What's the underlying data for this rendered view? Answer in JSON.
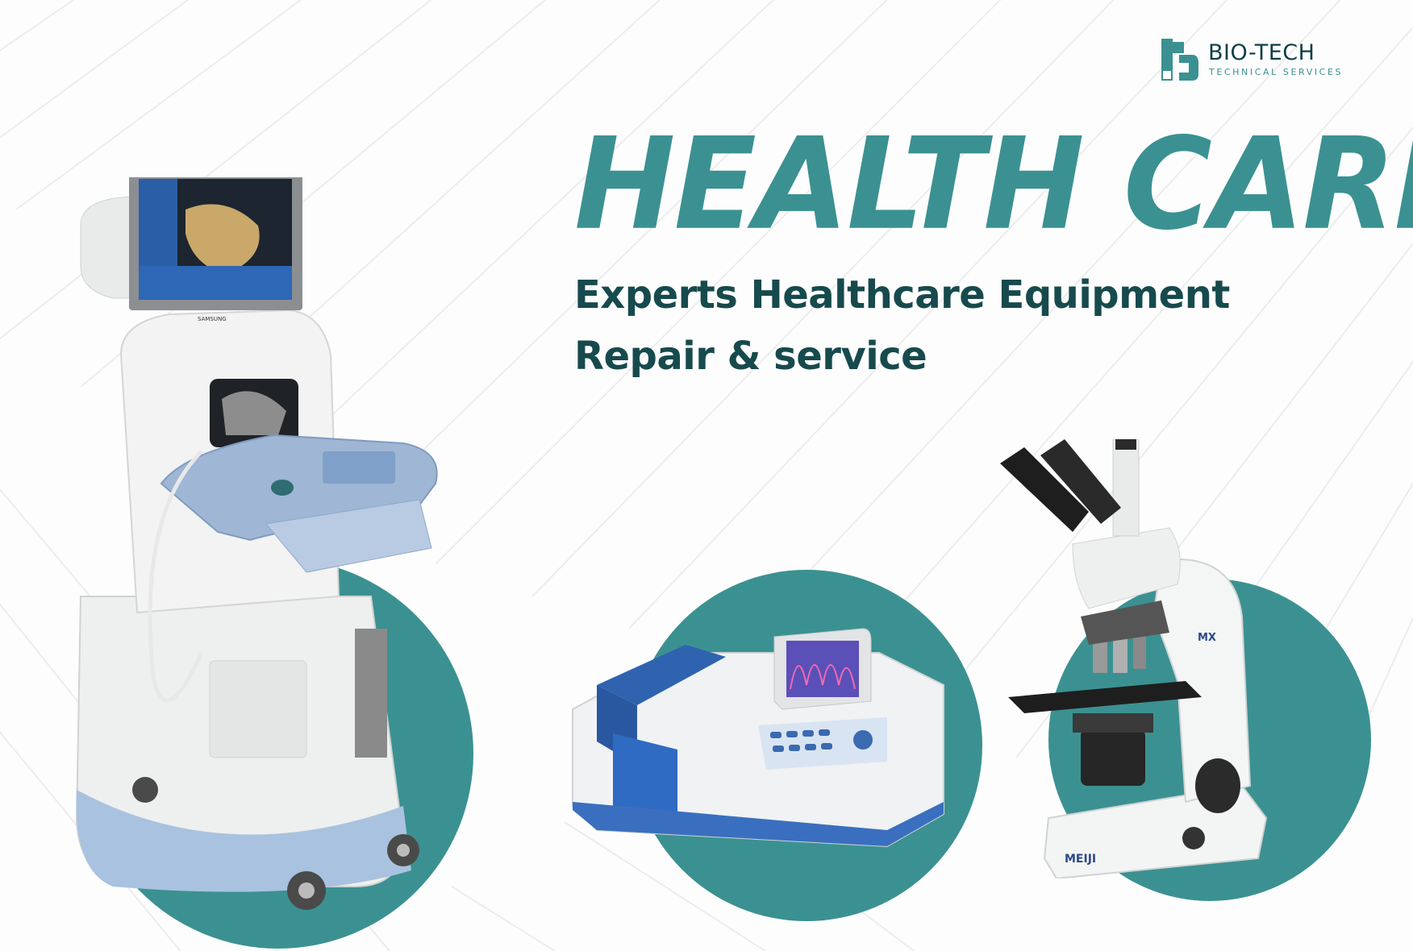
{
  "brand": {
    "name": "BIO-TECH",
    "tagline": "TECHNICAL SERVICES",
    "accent_color": "#3b9191",
    "dark_color": "#174a4d"
  },
  "headline": "HEALTH CARE",
  "subheadline": {
    "line1": "Experts Healthcare Equipment",
    "line2": "Repair & service"
  },
  "devices": {
    "ultrasound": {
      "monitor_brand": "SAMSUNG"
    },
    "spectrophotometer": {},
    "microscope": {
      "badge": "MX",
      "brand": "MEIJI"
    }
  }
}
